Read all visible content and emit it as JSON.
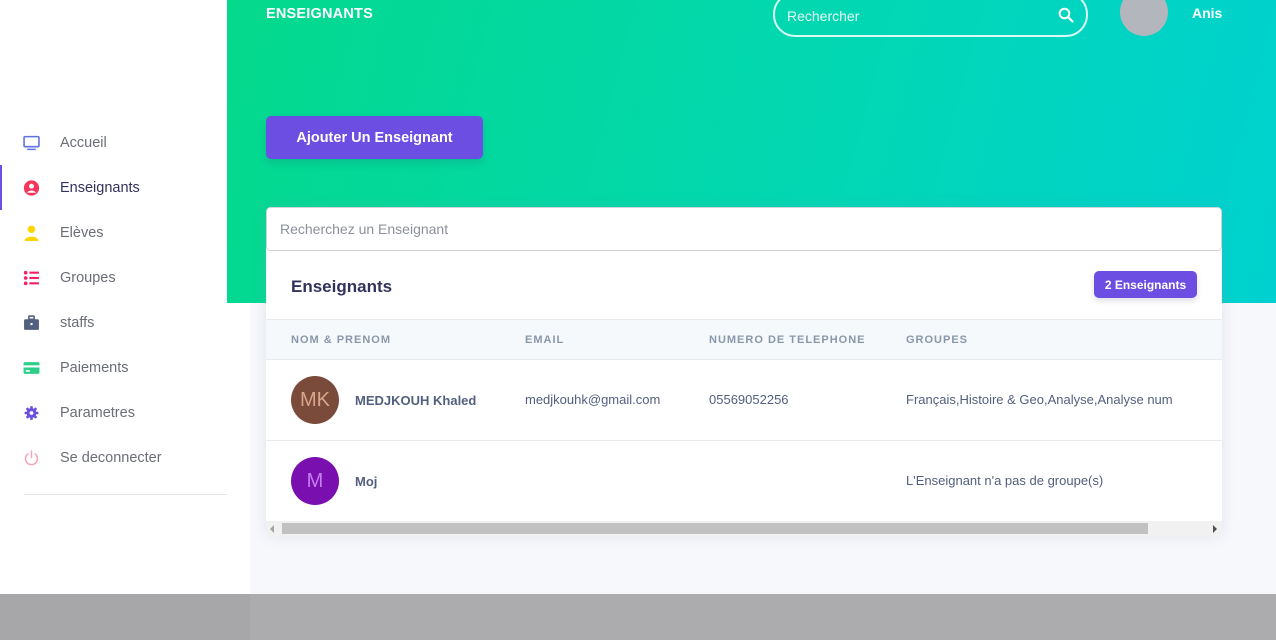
{
  "header": {
    "title": "ENSEIGNANTS",
    "search_placeholder": "Rechercher",
    "user_name": "Anis"
  },
  "sidebar": {
    "items": [
      {
        "label": "Accueil",
        "icon": "monitor-icon",
        "color": "#5e72e4"
      },
      {
        "label": "Enseignants",
        "icon": "user-circle-icon",
        "color": "#f5365c",
        "active": true
      },
      {
        "label": "Elèves",
        "icon": "person-icon",
        "color": "#ffd600"
      },
      {
        "label": "Groupes",
        "icon": "list-icon",
        "color": "#f3206b"
      },
      {
        "label": "staffs",
        "icon": "briefcase-icon",
        "color": "#525f7f"
      },
      {
        "label": "Paiements",
        "icon": "credit-card-icon",
        "color": "#2dce89"
      },
      {
        "label": "Parametres",
        "icon": "gear-icon",
        "color": "#6c4ee2"
      },
      {
        "label": "Se deconnecter",
        "icon": "power-icon",
        "color": "#f3a4b5"
      }
    ]
  },
  "actions": {
    "add_button_label": "Ajouter Un Enseignant"
  },
  "card": {
    "filter_placeholder": "Recherchez un Enseignant",
    "title": "Enseignants",
    "count_badge": "2 Enseignants",
    "columns": [
      "NOM & PRENOM",
      "EMAIL",
      "NUMERO DE TELEPHONE",
      "GROUPES"
    ],
    "rows": [
      {
        "initials": "MK",
        "avatar_color": "#7a4a3a",
        "initials_color": "#d9a58b",
        "name": "MEDJKOUH Khaled",
        "email": "medjkouhk@gmail.com",
        "phone": "05569052256",
        "groups": "Français,Histoire & Geo,Analyse,Analyse num"
      },
      {
        "initials": "M",
        "avatar_color": "#7a0fb0",
        "initials_color": "#c47ef0",
        "name": "Moj",
        "email": "",
        "phone": "",
        "groups": "L'Enseignant n'a pas de groupe(s)"
      }
    ]
  },
  "colors": {
    "accent": "#6c4ee2",
    "hero_gradient_start": "#04d98c",
    "hero_gradient_end": "#00d1d0"
  }
}
